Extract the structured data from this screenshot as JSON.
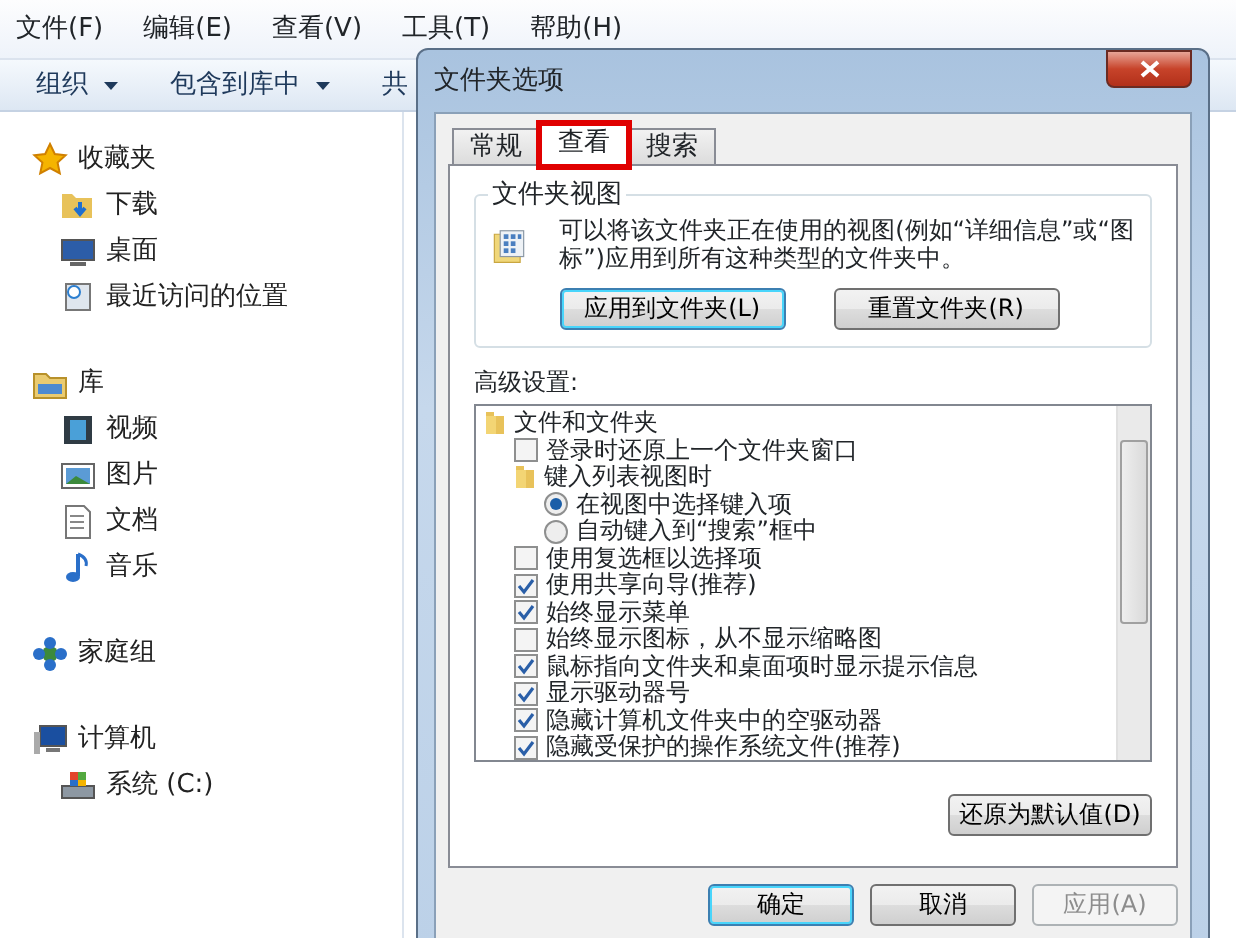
{
  "explorer": {
    "menu": [
      "文件(F)",
      "编辑(E)",
      "查看(V)",
      "工具(T)",
      "帮助(H)"
    ],
    "toolbar": [
      {
        "label": "组织",
        "dropdown": true
      },
      {
        "label": "包含到库中",
        "dropdown": true
      },
      {
        "label": "共",
        "dropdown": false
      }
    ],
    "nav": [
      {
        "label": "收藏夹",
        "children": [
          {
            "label": "下载"
          },
          {
            "label": "桌面"
          },
          {
            "label": "最近访问的位置"
          }
        ]
      },
      {
        "label": "库",
        "children": [
          {
            "label": "视频"
          },
          {
            "label": "图片"
          },
          {
            "label": "文档"
          },
          {
            "label": "音乐"
          }
        ]
      },
      {
        "label": "家庭组"
      },
      {
        "label": "计算机",
        "children": [
          {
            "label": "系统 (C:)"
          }
        ]
      }
    ]
  },
  "dialog": {
    "title": "文件夹选项",
    "tabs": [
      {
        "label": "常规",
        "selected": false,
        "highlighted": false
      },
      {
        "label": "查看",
        "selected": true,
        "highlighted": true
      },
      {
        "label": "搜索",
        "selected": false,
        "highlighted": false
      }
    ],
    "folder_views": {
      "heading": "文件夹视图",
      "description": "可以将该文件夹正在使用的视图(例如“详细信息”或“图标”)应用到所有这种类型的文件夹中。",
      "buttons": [
        "应用到文件夹(L)",
        "重置文件夹(R)"
      ]
    },
    "advanced_label": "高级设置:",
    "settings": [
      {
        "kind": "folder",
        "label": "文件和文件夹",
        "children": [
          {
            "kind": "checkbox",
            "label": "登录时还原上一个文件夹窗口",
            "checked": false
          },
          {
            "kind": "folder",
            "label": "键入列表视图时",
            "children": [
              {
                "kind": "radio",
                "label": "在视图中选择键入项",
                "selected": true
              },
              {
                "kind": "radio",
                "label": "自动键入到“搜索”框中",
                "selected": false
              }
            ]
          },
          {
            "kind": "checkbox",
            "label": "使用复选框以选择项",
            "checked": false
          },
          {
            "kind": "checkbox",
            "label": "使用共享向导(推荐)",
            "checked": true
          },
          {
            "kind": "checkbox",
            "label": "始终显示菜单",
            "checked": true
          },
          {
            "kind": "checkbox",
            "label": "始终显示图标，从不显示缩略图",
            "checked": false
          },
          {
            "kind": "checkbox",
            "label": "鼠标指向文件夹和桌面项时显示提示信息",
            "checked": true
          },
          {
            "kind": "checkbox",
            "label": "显示驱动器号",
            "checked": true
          },
          {
            "kind": "checkbox",
            "label": "隐藏计算机文件夹中的空驱动器",
            "checked": true
          },
          {
            "kind": "checkbox",
            "label": "隐藏受保护的操作系统文件(推荐)",
            "checked": true
          }
        ]
      }
    ],
    "restore_button": "还原为默认值(D)",
    "buttons": [
      {
        "label": "确定",
        "disabled": false
      },
      {
        "label": "取消",
        "disabled": false
      },
      {
        "label": "应用(A)",
        "disabled": true
      }
    ]
  }
}
